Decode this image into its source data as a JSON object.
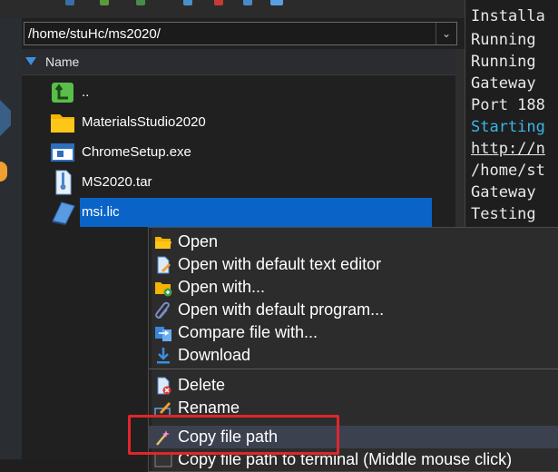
{
  "file_panel": {
    "path": "/home/stuHc/ms2020/",
    "column_name": "Name",
    "files": [
      {
        "name": "..",
        "icon": "parent-folder-icon"
      },
      {
        "name": "MaterialsStudio2020",
        "icon": "folder-icon"
      },
      {
        "name": "ChromeSetup.exe",
        "icon": "exe-icon"
      },
      {
        "name": "MS2020.tar",
        "icon": "archive-icon"
      },
      {
        "name": "msi.lic",
        "icon": "file-icon"
      }
    ]
  },
  "terminal": {
    "lines": [
      "Installa",
      "Running",
      "Running",
      "Gateway",
      "Port 188",
      "Starting",
      "http://n",
      "/home/st",
      "Gateway",
      "Testing"
    ]
  },
  "context_menu": {
    "items": [
      {
        "label": "Open",
        "icon": "folder-open-icon"
      },
      {
        "label": "Open with default text editor",
        "icon": "text-editor-icon"
      },
      {
        "label": "Open with...",
        "icon": "open-with-icon"
      },
      {
        "label": "Open with default program...",
        "icon": "paperclip-icon"
      },
      {
        "label": "Compare file with...",
        "icon": "compare-icon"
      },
      {
        "label": "Download",
        "icon": "download-icon"
      },
      {
        "label": "Delete",
        "icon": "delete-icon"
      },
      {
        "label": "Rename",
        "icon": "rename-icon"
      },
      {
        "label": "Copy file path",
        "icon": "copy-path-icon"
      },
      {
        "label": "Copy file path to terminal (Middle mouse click)",
        "icon": "terminal-icon"
      }
    ]
  },
  "colors": {
    "selection": "#0a64c8",
    "highlight_box": "#e0262b",
    "terminal_cyan": "#3ab7e8"
  }
}
